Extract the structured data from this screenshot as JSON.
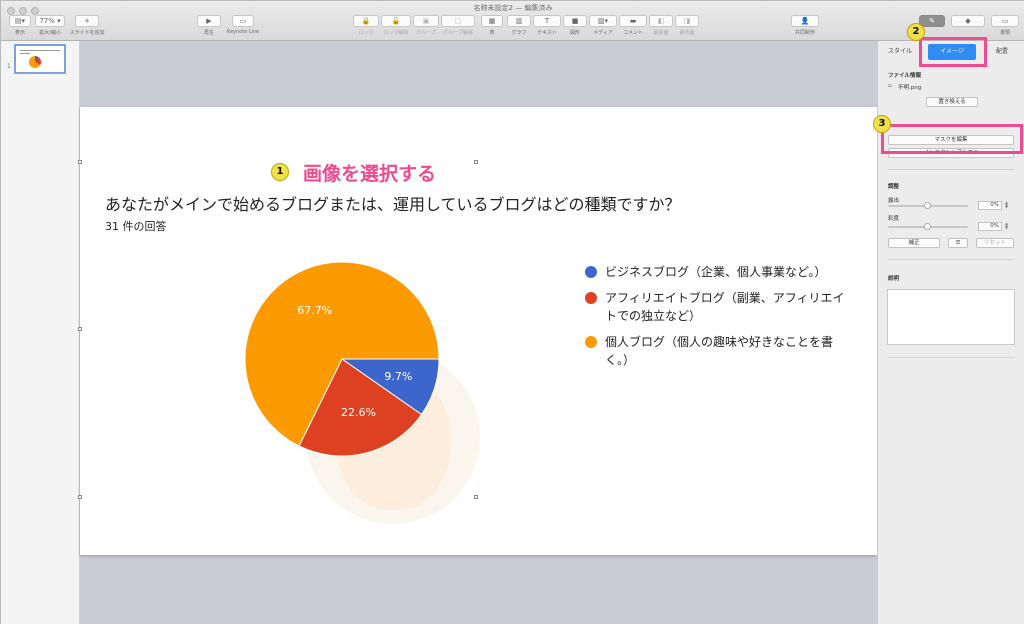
{
  "window": {
    "title": "名称未設定2 — 編集済み"
  },
  "toolbar": {
    "left": [
      {
        "label": "表示",
        "btn": "▤▾"
      },
      {
        "label": "拡大/縮小",
        "btn": "77% ▾"
      },
      {
        "label": "スライドを追加",
        "btn": "+"
      }
    ],
    "center": [
      {
        "label": "再生",
        "btn": "▶"
      },
      {
        "label": "Keynote Live",
        "btn": "▭"
      }
    ],
    "tools": [
      {
        "label": "ロック",
        "btn": "🔒"
      },
      {
        "label": "ロック解除",
        "btn": "🔓"
      },
      {
        "label": "グループ",
        "btn": "▣"
      },
      {
        "label": "グループ解除",
        "btn": "▢"
      },
      {
        "label": "表",
        "btn": "▦"
      },
      {
        "label": "グラフ",
        "btn": "▥"
      },
      {
        "label": "テキスト",
        "btn": "T"
      },
      {
        "label": "図形",
        "btn": "■"
      },
      {
        "label": "メディア",
        "btn": "▨▾"
      },
      {
        "label": "コメント",
        "btn": "▬"
      },
      {
        "label": "最前面",
        "btn": "◧"
      },
      {
        "label": "最背面",
        "btn": "◨"
      }
    ],
    "share": {
      "label": "共同制作",
      "btn": "👤"
    },
    "right": [
      {
        "label": "フォーマット",
        "btn": "✎"
      },
      {
        "label": "アニメーション",
        "btn": "◆"
      },
      {
        "label": "書類",
        "btn": "▭"
      }
    ]
  },
  "navigator": {
    "slide_number": "1"
  },
  "slide": {
    "question": "あなたがメインで始めるブログまたは、運用しているブログはどの種類ですか？",
    "response_count": "31 件の回答",
    "legend": [
      {
        "label": "ビジネスブログ（企業、個人事業など。）",
        "color": "#3c66cc"
      },
      {
        "label": "アフィリエイトブログ（副業、アフィリエイトでの独立など）",
        "color": "#dd4121"
      },
      {
        "label": "個人ブログ（個人の趣味や好きなことを書く。）",
        "color": "#fb9a03"
      }
    ]
  },
  "chart_data": {
    "type": "pie",
    "categories": [
      "ビジネスブログ（企業、個人事業など。）",
      "アフィリエイトブログ（副業、アフィリエイトでの独立など）",
      "個人ブログ（個人の趣味や好きなことを書く。）"
    ],
    "values": [
      9.7,
      22.6,
      67.7
    ],
    "labels": [
      "9.7%",
      "22.6%",
      "67.7%"
    ],
    "colors": [
      "#3c66cc",
      "#dd4121",
      "#fb9a03"
    ],
    "title": "あなたがメインで始めるブログまたは、運用しているブログはどの種類ですか？",
    "subtitle": "31 件の回答"
  },
  "callouts": {
    "step1_num": "1",
    "step1_text": "画像を選択する",
    "step2_num": "2",
    "step3_num": "3"
  },
  "inspector": {
    "tabs": {
      "style": "スタイル",
      "image": "イメージ",
      "arrange": "配置"
    },
    "file_info_heading": "ファイル情報",
    "file_name": "不明.png",
    "replace_button": "置き換える",
    "edit_mask_button": "マスクを編集",
    "instant_alpha_button": "インスタントアルファ",
    "adjust_heading": "調整",
    "exposure_label": "露出",
    "exposure_value": "0%",
    "saturation_label": "彩度",
    "saturation_value": "0%",
    "enhance_button": "補正",
    "reset_button": "リセット",
    "description_heading": "説明"
  }
}
